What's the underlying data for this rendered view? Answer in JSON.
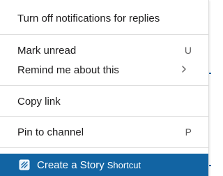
{
  "menu": {
    "section1": {
      "turn_off_notifications": "Turn off notifications for replies"
    },
    "section2": {
      "mark_unread": {
        "label": "Mark unread",
        "shortcut": "U"
      },
      "remind_me": {
        "label": "Remind me about this",
        "submenu_icon": "chevron-right-icon"
      }
    },
    "section3": {
      "copy_link": "Copy link"
    },
    "section4": {
      "pin_to_channel": {
        "label": "Pin to channel",
        "shortcut": "P"
      }
    },
    "workflow": {
      "create_story": {
        "label": "Create a Story",
        "hint": "Shortcut",
        "icon": "story-shortcut-icon"
      }
    }
  },
  "colors": {
    "highlight": "#1264a3",
    "text": "#1d1c1d",
    "shortcut_text": "#616061",
    "divider": "#dddddd"
  }
}
